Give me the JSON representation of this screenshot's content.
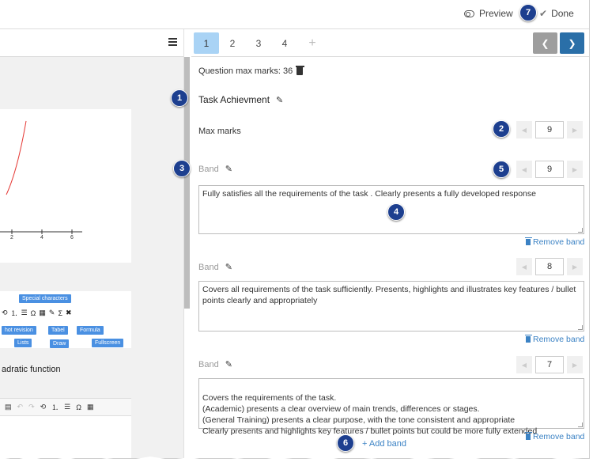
{
  "topbar": {
    "preview_label": "Preview",
    "done_label": "Done"
  },
  "left": {
    "chart": {
      "x_ticks": [
        "2",
        "4",
        "6"
      ]
    },
    "toolbar_callouts": {
      "special": "Special characters",
      "revision": "hot revision",
      "lists": "Lists",
      "tabel": "Tabel",
      "formula": "Formula",
      "draw": "Draw",
      "fullscreen": "Fullscreen"
    },
    "quadratic_text": "adratic function"
  },
  "pager": {
    "pages": [
      "1",
      "2",
      "3",
      "4"
    ],
    "add": "+",
    "active": "1"
  },
  "question": {
    "max_marks_label": "Question max marks: 36",
    "task_title": "Task Achievment",
    "max_marks_row_label": "Max marks",
    "max_marks_value": "9"
  },
  "bands": [
    {
      "label": "Band",
      "value": "9",
      "text": "Fully satisfies all the requirements of the task . Clearly presents a fully developed response",
      "remove": "Remove band"
    },
    {
      "label": "Band",
      "value": "8",
      "text": "Covers all requirements of the task sufficiently. Presents, highlights and illustrates key features / bullet points clearly and appropriately",
      "remove": "Remove band"
    },
    {
      "label": "Band",
      "value": "7",
      "text": "Covers the requirements of the task.\n(Academic) presents a clear overview of main trends, differences or stages.\n(General Training) presents a clear purpose, with the tone consistent and appropriate\nClearly presents and highlights key features / bullet points but could be more fully extended",
      "remove": "Remove band"
    }
  ],
  "add_band": "+ Add band",
  "badges": [
    "1",
    "2",
    "3",
    "4",
    "5",
    "6",
    "7"
  ],
  "colors": {
    "accent": "#3b82c4",
    "badge": "#1d3f8f",
    "active_page": "#a9d3f5",
    "next_button": "#2a6fa8"
  }
}
